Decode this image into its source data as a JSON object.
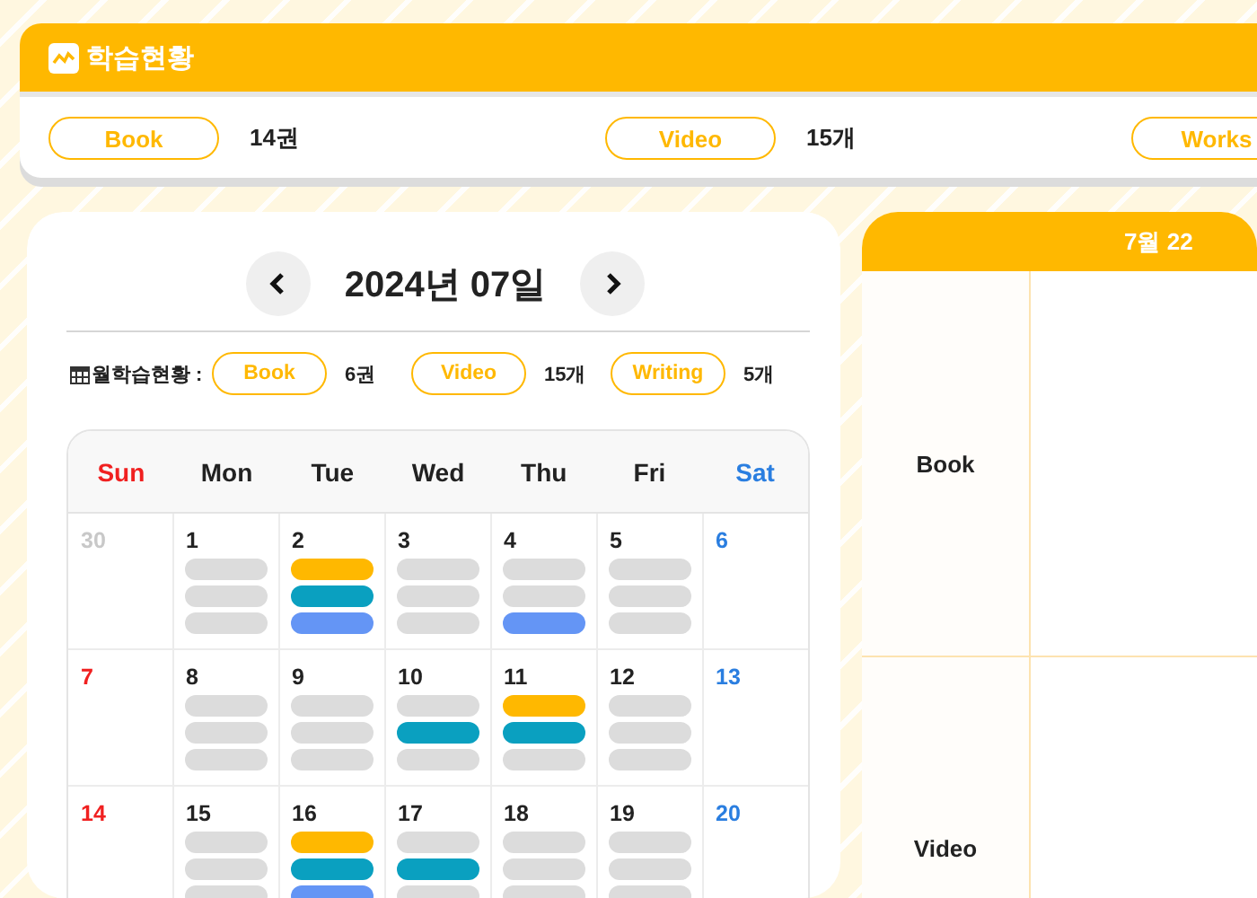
{
  "header": {
    "title": "학습현황",
    "stats": [
      {
        "label": "Book",
        "count": "14권"
      },
      {
        "label": "Video",
        "count": "15개"
      },
      {
        "label": "Works"
      }
    ]
  },
  "calendar": {
    "title": "2024년 07일",
    "summary_label": "월학습현황 :",
    "summary": [
      {
        "label": "Book",
        "count": "6권"
      },
      {
        "label": "Video",
        "count": "15개"
      },
      {
        "label": "Writing",
        "count": "5개"
      }
    ],
    "weekdays": [
      "Sun",
      "Mon",
      "Tue",
      "Wed",
      "Thu",
      "Fri",
      "Sat"
    ],
    "weeks": [
      {
        "days": [
          {
            "day": "30",
            "other_month": true
          },
          {
            "day": "1",
            "book": false,
            "video": false,
            "writing": false
          },
          {
            "day": "2",
            "book": true,
            "video": true,
            "writing": true
          },
          {
            "day": "3",
            "book": false,
            "video": false,
            "writing": false
          },
          {
            "day": "4",
            "book": false,
            "video": false,
            "writing": true
          },
          {
            "day": "5",
            "book": false,
            "video": false,
            "writing": false
          },
          {
            "day": "6",
            "other_month": false
          }
        ]
      },
      {
        "days": [
          {
            "day": "7",
            "other_month": false
          },
          {
            "day": "8",
            "book": false,
            "video": false,
            "writing": false
          },
          {
            "day": "9",
            "book": false,
            "video": false,
            "writing": false
          },
          {
            "day": "10",
            "book": false,
            "video": true,
            "writing": false
          },
          {
            "day": "11",
            "book": true,
            "video": true,
            "writing": false
          },
          {
            "day": "12",
            "book": false,
            "video": false,
            "writing": false
          },
          {
            "day": "13",
            "other_month": false
          }
        ]
      },
      {
        "days": [
          {
            "day": "14",
            "other_month": false
          },
          {
            "day": "15",
            "book": false,
            "video": false,
            "writing": false
          },
          {
            "day": "16",
            "book": true,
            "video": true,
            "writing": true
          },
          {
            "day": "17",
            "book": false,
            "video": true,
            "writing": false
          },
          {
            "day": "18",
            "book": false,
            "video": false,
            "writing": false
          },
          {
            "day": "19",
            "book": false,
            "video": false,
            "writing": false
          },
          {
            "day": "20",
            "other_month": false
          }
        ]
      }
    ]
  },
  "day_panel": {
    "title": "7월 22",
    "rows": [
      {
        "label": "Book"
      },
      {
        "label": "Video"
      }
    ]
  }
}
